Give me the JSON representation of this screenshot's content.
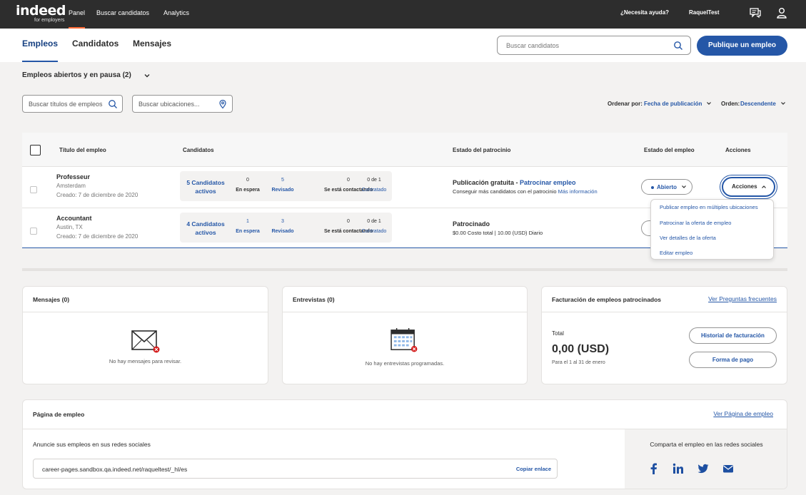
{
  "topbar": {
    "logo_text": "indeed",
    "logo_sub": "for employers",
    "nav": [
      "Panel",
      "Buscar candidatos",
      "Analytics"
    ],
    "help": "¿Necesita ayuda?",
    "user": "RaquelTest"
  },
  "subnav": {
    "tabs": [
      "Empleos",
      "Candidatos",
      "Mensajes"
    ],
    "search_placeholder": "Buscar candidatos",
    "publish_button": "Publique un empleo"
  },
  "filters": {
    "title": "Empleos abiertos y en pausa (2)",
    "search_titles_placeholder": "Buscar títulos de empleos",
    "search_locations_placeholder": "Buscar ubicaciones...",
    "sort_by_label": "Ordenar por:",
    "sort_by_value": "Fecha de publicación",
    "order_label": "Orden:",
    "order_value": "Descendente"
  },
  "table": {
    "headers": [
      "Título del empleo",
      "Candidatos",
      "Estado del patrocinio",
      "Estado del empleo",
      "Acciones"
    ],
    "rows": [
      {
        "title": "Professeur",
        "location": "Amsterdam",
        "created": "Creado: 7 de diciembre de 2020",
        "candidates_line1": "5 Candidatos",
        "candidates_line2": "activos",
        "stats": [
          {
            "n": "0",
            "label": "En espera"
          },
          {
            "n": "5",
            "label": "Revisado"
          },
          {
            "n": "0",
            "label": "Se está contactando"
          },
          {
            "n": "0 de 1",
            "label": "Contratado"
          }
        ],
        "sponsorship_title": "Publicación gratuita - ",
        "sponsorship_link": "Patrocinar empleo",
        "sponsorship_sub": "Conseguir más candidatos con el patrocinio ",
        "sponsorship_sub_link": "Más información",
        "status": "Abierto",
        "actions": "Acciones"
      },
      {
        "title": "Accountant",
        "location": "Austin, TX",
        "created": "Creado: 7 de diciembre de 2020",
        "candidates_line1": "4 Candidatos",
        "candidates_line2": "activos",
        "stats": [
          {
            "n": "1",
            "label": "En espera"
          },
          {
            "n": "3",
            "label": "Revisado"
          },
          {
            "n": "0",
            "label": "Se está contactando"
          },
          {
            "n": "0 de 1",
            "label": "Contratado"
          }
        ],
        "sponsorship_title": "Patrocinado",
        "sponsorship_sub": "$0.00 Costo total | 10.00 (USD) Diario"
      }
    ]
  },
  "actions_menu": [
    "Publicar empleo en múltiples ubicaciones",
    "Patrocinar la oferta de empleo",
    "Ver detalles de la oferta",
    "Editar empleo"
  ],
  "cards": {
    "messages": {
      "title": "Mensajes (0)",
      "empty": "No hay mensajes para revisar."
    },
    "interviews": {
      "title": "Entrevistas (0)",
      "empty": "No hay entrevistas programadas."
    },
    "billing": {
      "title": "Facturación de empleos patrocinados",
      "link": "Ver Preguntas frecuentes",
      "total_label": "Total",
      "total_value": "0,00 (USD)",
      "period": "Para el 1 al 31 de enero",
      "history_button": "Historial de facturación",
      "payment_button": "Forma de pago"
    }
  },
  "job_page": {
    "title": "Página de empleo",
    "link": "Ver Página de empleo",
    "announce": "Anuncie sus empleos en sus redes sociales",
    "url": "career-pages.sandbox.qa.indeed.net/raqueltest/_hl/es",
    "copy": "Copiar enlace",
    "share": "Comparta el empleo en las redes sociales"
  },
  "colors": {
    "accent": "#2557a7",
    "topbar": "#2d2d2d",
    "active_tab_underline": "#ff6b35"
  }
}
